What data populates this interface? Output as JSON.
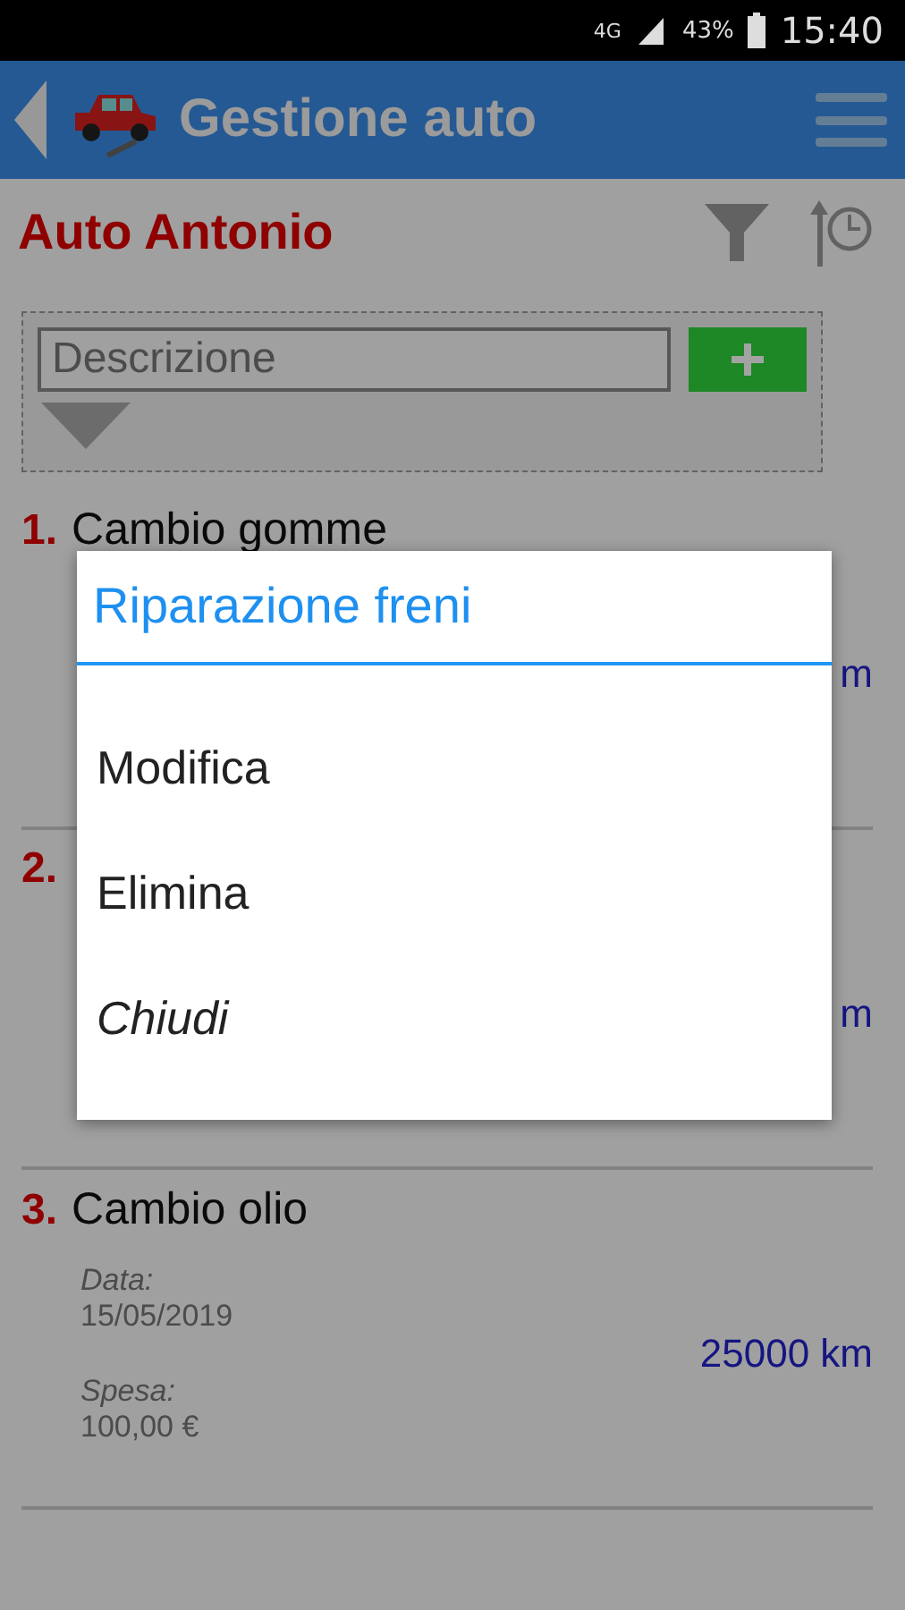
{
  "status_bar": {
    "network": "4G",
    "battery": "43%",
    "time": "15:40"
  },
  "header": {
    "title": "Gestione auto"
  },
  "car_name": "Auto Antonio",
  "form": {
    "placeholder": "Descrizione"
  },
  "entries": [
    {
      "number": "1.",
      "title": "Cambio gomme",
      "km": "m"
    },
    {
      "number": "2.",
      "km": "m"
    },
    {
      "number": "3.",
      "title": "Cambio olio",
      "date_label": "Data:",
      "date": "15/05/2019",
      "km": "25000 km",
      "spesa_label": "Spesa:",
      "spesa": "100,00 €"
    }
  ],
  "dialog": {
    "title": "Riparazione freni",
    "items": [
      {
        "label": "Modifica",
        "kind": "action"
      },
      {
        "label": "Elimina",
        "kind": "action"
      },
      {
        "label": "Chiudi",
        "kind": "cancel"
      }
    ]
  }
}
